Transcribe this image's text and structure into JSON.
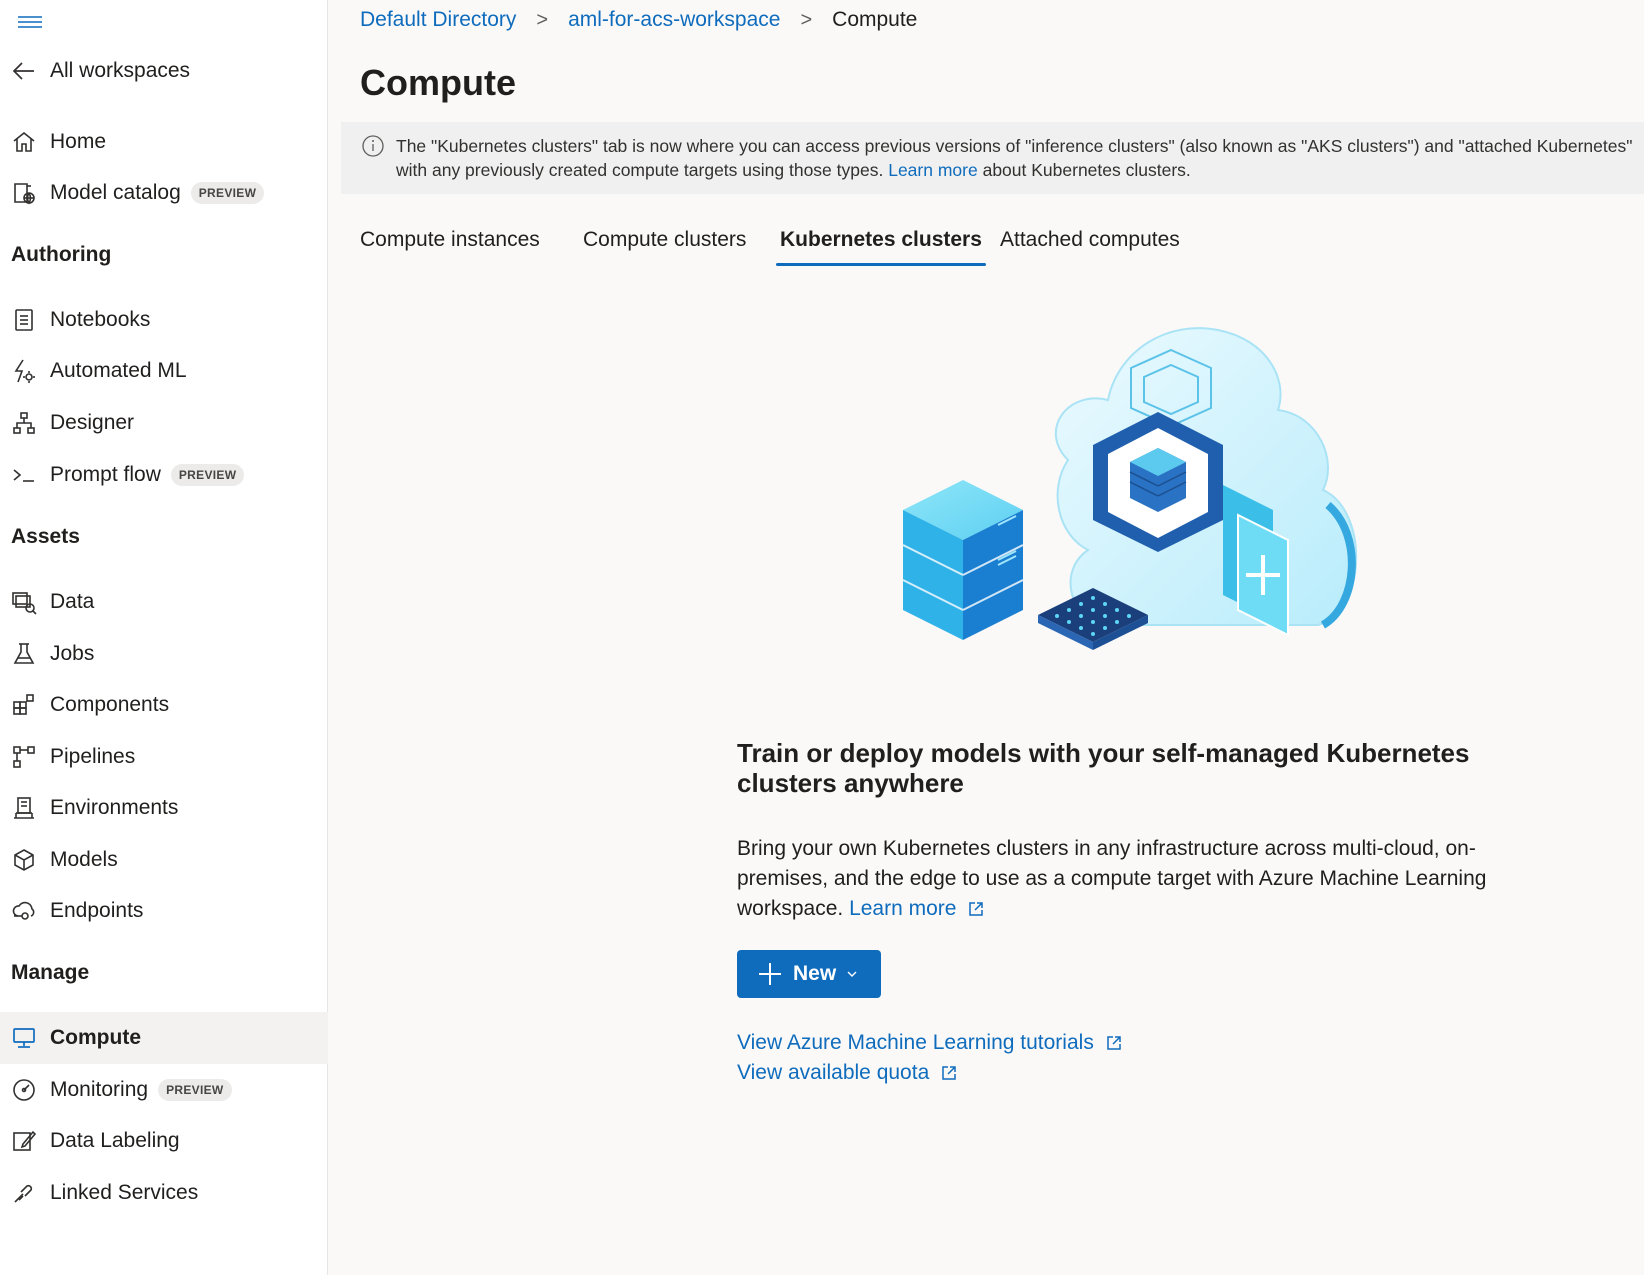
{
  "sidebar": {
    "back_label": "All workspaces",
    "top_items": [
      {
        "label": "Home",
        "icon": "home-icon"
      },
      {
        "label": "Model catalog",
        "icon": "model-catalog-icon",
        "badge": "PREVIEW"
      }
    ],
    "sections": {
      "authoring": "Authoring",
      "assets": "Assets",
      "manage": "Manage"
    },
    "authoring_items": [
      {
        "label": "Notebooks",
        "icon": "notebook-icon"
      },
      {
        "label": "Automated ML",
        "icon": "automated-ml-icon"
      },
      {
        "label": "Designer",
        "icon": "designer-icon"
      },
      {
        "label": "Prompt flow",
        "icon": "prompt-flow-icon",
        "badge": "PREVIEW"
      }
    ],
    "asset_items": [
      {
        "label": "Data",
        "icon": "data-icon"
      },
      {
        "label": "Jobs",
        "icon": "jobs-flask-icon"
      },
      {
        "label": "Components",
        "icon": "components-icon"
      },
      {
        "label": "Pipelines",
        "icon": "pipelines-icon"
      },
      {
        "label": "Environments",
        "icon": "environments-icon"
      },
      {
        "label": "Models",
        "icon": "models-cube-icon"
      },
      {
        "label": "Endpoints",
        "icon": "endpoints-icon"
      }
    ],
    "manage_items": [
      {
        "label": "Compute",
        "icon": "compute-monitor-icon",
        "active": true
      },
      {
        "label": "Monitoring",
        "icon": "monitoring-gauge-icon",
        "badge": "PREVIEW"
      },
      {
        "label": "Data Labeling",
        "icon": "data-labeling-icon"
      },
      {
        "label": "Linked Services",
        "icon": "linked-services-icon"
      }
    ]
  },
  "breadcrumb": {
    "items": [
      "Default Directory",
      "aml-for-acs-workspace",
      "Compute"
    ],
    "separator": ">"
  },
  "page": {
    "title": "Compute"
  },
  "info_bar": {
    "line1": "The \"Kubernetes clusters\" tab is now where you can access previous versions of \"inference clusters\" (also known as \"AKS clusters\") and \"attached Kubernetes\"",
    "line2_prefix": "with any previously created compute targets using those types.",
    "line2_link": "Learn more",
    "line2_suffix": "about Kubernetes clusters."
  },
  "tabs": [
    {
      "label": "Compute instances",
      "active": false
    },
    {
      "label": "Compute clusters",
      "active": false
    },
    {
      "label": "Kubernetes clusters",
      "active": true
    },
    {
      "label": "Attached computes",
      "active": false
    }
  ],
  "empty_state": {
    "title": "Train or deploy models with your self-managed Kubernetes clusters anywhere",
    "description": "Bring your own Kubernetes clusters in any infrastructure across multi-cloud, on-premises, and the edge to use as a compute target with Azure Machine Learning workspace.",
    "learn_more": "Learn more",
    "new_button": "New",
    "links": [
      "View Azure Machine Learning tutorials",
      "View available quota"
    ]
  },
  "colors": {
    "accent": "#0f6cbd",
    "active_nav_bg": "#f3f2f1",
    "info_bar_bg": "#f0f0f0"
  }
}
